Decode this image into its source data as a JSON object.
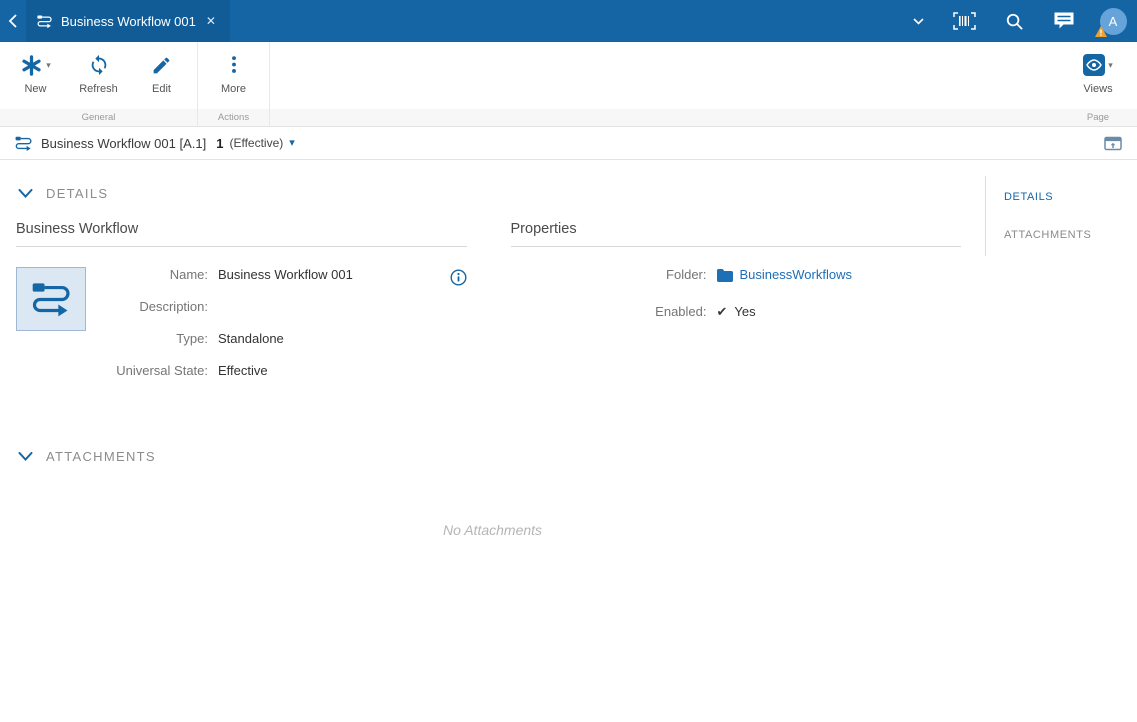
{
  "colors": {
    "topbar": "#1565a4",
    "tab": "#115c97",
    "accent": "#1566a5",
    "link": "#1d6fb8",
    "warning": "#f0a030",
    "tile_bg": "#dbe7f3"
  },
  "topbar": {
    "tab_title": "Business Workflow 001",
    "avatar_initial": "A"
  },
  "ribbon": {
    "buttons": [
      {
        "label": "New",
        "icon": "asterisk-icon",
        "has_dropdown": true
      },
      {
        "label": "Refresh",
        "icon": "refresh-icon"
      },
      {
        "label": "Edit",
        "icon": "pencil-icon"
      },
      {
        "label": "More",
        "icon": "ellipsis-icon"
      },
      {
        "label": "Views",
        "icon": "eye-icon",
        "has_dropdown": true
      }
    ],
    "groups": {
      "general": "General",
      "actions": "Actions",
      "page": "Page"
    }
  },
  "record_header": {
    "title": "Business Workflow 001 [A.1]",
    "revision": "1",
    "state": "(Effective)"
  },
  "details": {
    "section_title": "DETAILS",
    "form_title": "Business Workflow",
    "fields": [
      {
        "label": "Name:",
        "value": "Business Workflow 001"
      },
      {
        "label": "Description:",
        "value": ""
      },
      {
        "label": "Type:",
        "value": "Standalone"
      },
      {
        "label": "Universal State:",
        "value": "Effective"
      }
    ],
    "properties_title": "Properties",
    "folder_label": "Folder:",
    "folder_value": "BusinessWorkflows",
    "enabled_label": "Enabled:",
    "enabled_value": "Yes",
    "check_glyph": "✔"
  },
  "attachments": {
    "section_title": "ATTACHMENTS",
    "empty_text": "No Attachments"
  },
  "side_nav": {
    "items": [
      {
        "label": "DETAILS",
        "active": true
      },
      {
        "label": "ATTACHMENTS",
        "active": false
      }
    ]
  }
}
